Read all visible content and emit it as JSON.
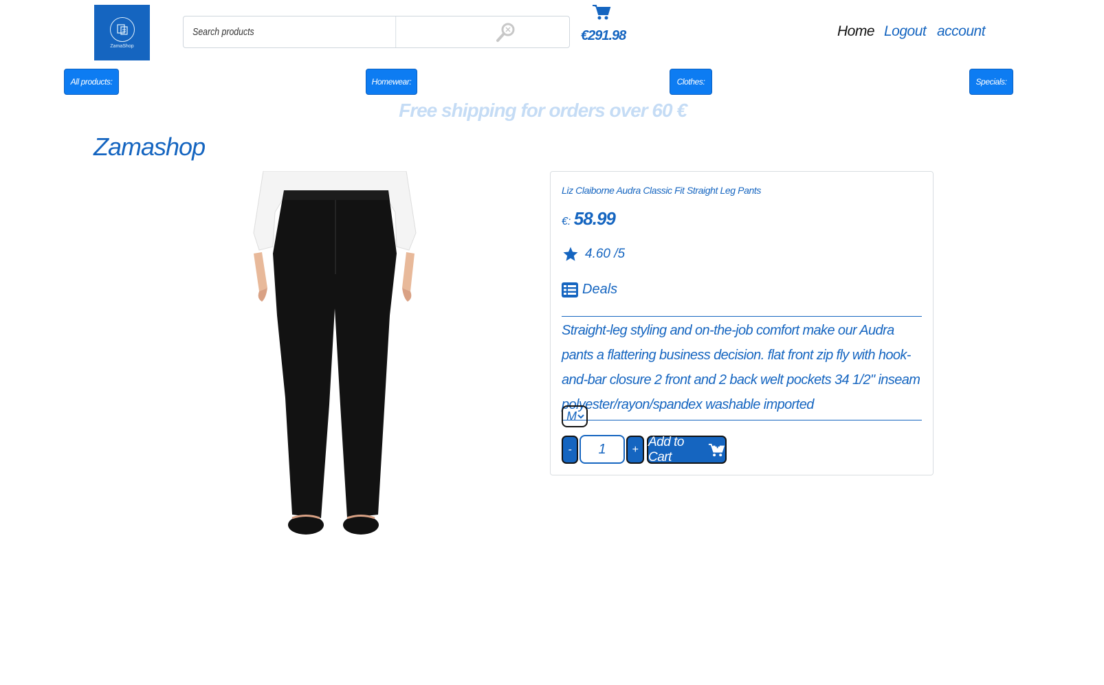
{
  "header": {
    "logo_text": "ZamaShop",
    "search": {
      "placeholder": "Search products",
      "value": ""
    },
    "cart_total": "€291.98",
    "nav": {
      "home": "Home",
      "logout": "Logout",
      "account": "account"
    }
  },
  "categories": [
    {
      "label": "All products:"
    },
    {
      "label": "Homewear:"
    },
    {
      "label": "Clothes:"
    },
    {
      "label": "Specials:"
    }
  ],
  "banner": "Free shipping for orders over 60 €",
  "brand_title": "Zamashop",
  "product": {
    "name": "Liz Claiborne Audra Classic Fit Straight Leg Pants",
    "currency_label": "€:",
    "price": "58.99",
    "rating": "4.60 /5",
    "tag": "Deals",
    "description": "Straight-leg styling and on-the-job comfort make our Audra pants a flattering business decision. flat front zip fly with hook-and-bar closure 2 front and 2 back welt pockets 34 1/2\" inseam polyester/rayon/spandex washable imported",
    "size_selected": "M",
    "quantity": "1",
    "minus_label": "-",
    "plus_label": "+",
    "add_to_cart_label": "Add to Cart"
  },
  "icons": {
    "search": "search-icon",
    "cart": "cart-icon",
    "star": "star-icon",
    "list": "list-icon",
    "add_cart": "cart-plus-icon"
  },
  "colors": {
    "primary": "#1565c0",
    "category_bg": "#0d7cf2",
    "banner": "#c5dcf5"
  }
}
